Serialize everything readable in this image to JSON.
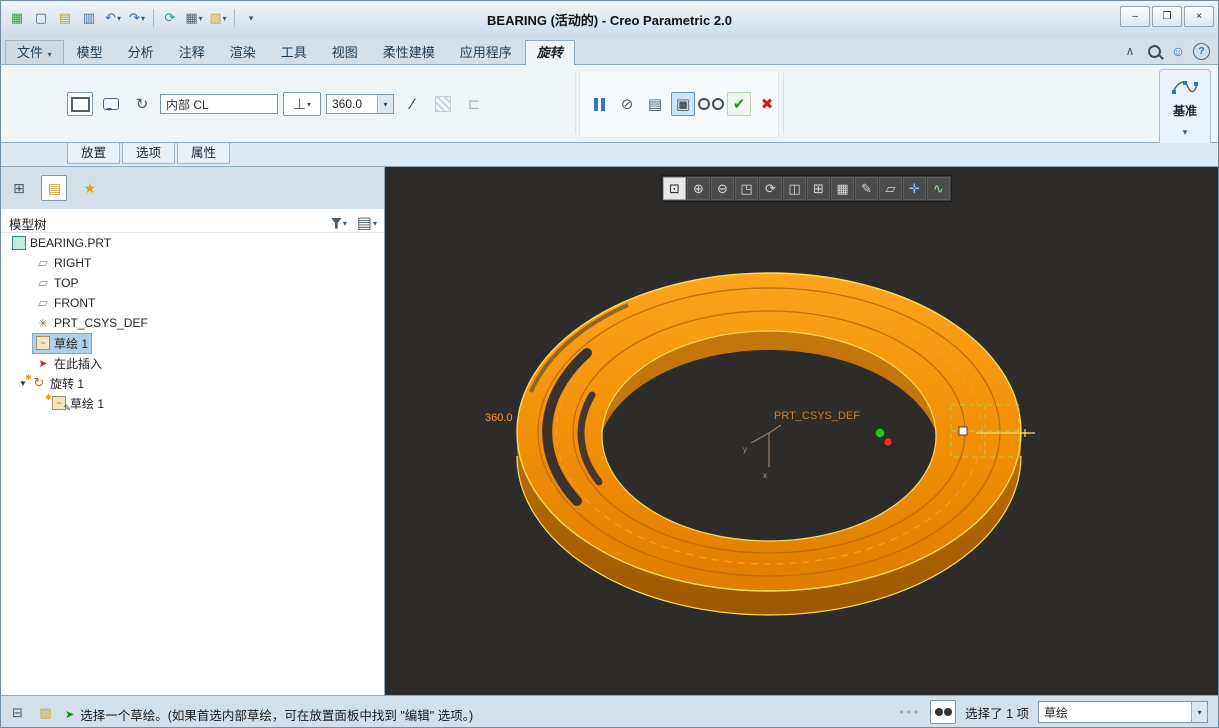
{
  "window": {
    "title": "BEARING (活动的) - Creo Parametric 2.0",
    "minimize_glyph": "–",
    "maximize_glyph": "❐",
    "close_glyph": "×"
  },
  "quick_access": {
    "icons": [
      {
        "name": "app-menu-icon",
        "glyph": "▦"
      },
      {
        "name": "new-file-icon",
        "glyph": "▢"
      },
      {
        "name": "open-file-icon",
        "glyph": "▤"
      },
      {
        "name": "save-icon",
        "glyph": "▥"
      },
      {
        "name": "undo-icon",
        "glyph": "↶",
        "arrow": "▾"
      },
      {
        "name": "redo-icon",
        "glyph": "↷",
        "arrow": "▾"
      },
      {
        "name": "regenerate-icon",
        "glyph": "⟳"
      },
      {
        "name": "windows-icon",
        "glyph": "▦",
        "arrow": "▾"
      },
      {
        "name": "open-folder-icon",
        "glyph": "▧",
        "arrow": "▾"
      },
      {
        "name": "customize-icon",
        "glyph": "▾"
      }
    ]
  },
  "tab_bar": {
    "tabs": [
      {
        "label": "文件",
        "arrow": "▾"
      },
      {
        "label": "模型"
      },
      {
        "label": "分析"
      },
      {
        "label": "注释"
      },
      {
        "label": "渲染"
      },
      {
        "label": "工具"
      },
      {
        "label": "视图"
      },
      {
        "label": "柔性建模"
      },
      {
        "label": "应用程序"
      },
      {
        "label": "旋转",
        "active": true
      }
    ],
    "right_icons": [
      {
        "name": "ribbon-collapse-icon",
        "glyph": "∧"
      },
      {
        "name": "search-icon",
        "glyph": "css-magnifier"
      },
      {
        "name": "community-icon",
        "glyph": "☺"
      },
      {
        "name": "help-icon",
        "glyph": "?"
      }
    ]
  },
  "ribbon": {
    "solid_button": "revolve-as-solid",
    "surface_button": "revolve-as-surface",
    "axis_glyph": "↻",
    "placement_value": "内部 CL",
    "angle_type_glyph": "⊥",
    "angle_type_arrow": "▾",
    "angle_value": "360.0",
    "reverse_glyph": "∕",
    "thin_glyph": "⊏",
    "no_preview_glyph": "⊘",
    "wireframe_preview_glyph": "▤",
    "shaded_preview_glyph": "▣",
    "ok_glyph": "✔",
    "cancel_glyph": "✖",
    "datum_group": {
      "label": "基准",
      "arrow": "▾"
    }
  },
  "panel_tabs": [
    {
      "label": "放置"
    },
    {
      "label": "选项"
    },
    {
      "label": "属性"
    }
  ],
  "model_tree": {
    "toolbar_icons": [
      {
        "name": "tree-display-icon",
        "glyph": "⊞"
      },
      {
        "name": "folder-navigator-icon",
        "glyph": "▤"
      },
      {
        "name": "favorites-icon",
        "glyph": "★"
      }
    ],
    "header": "模型树",
    "header_icons": [
      {
        "name": "filter-icon",
        "glyph": "css-funnel",
        "arrow": "▾"
      },
      {
        "name": "tree-columns-icon",
        "glyph": "▤",
        "arrow": "▾"
      }
    ],
    "items": [
      {
        "label": "BEARING.PRT",
        "icon": "part-icon",
        "level": 0
      },
      {
        "label": "RIGHT",
        "icon": "datum-plane-icon",
        "level": 1
      },
      {
        "label": "TOP",
        "icon": "datum-plane-icon",
        "level": 1
      },
      {
        "label": "FRONT",
        "icon": "datum-plane-icon",
        "level": 1
      },
      {
        "label": "PRT_CSYS_DEF",
        "icon": "csys-icon",
        "level": 1
      },
      {
        "label": "草绘 1",
        "icon": "sketch-icon",
        "level": 1,
        "selected": true
      },
      {
        "label": "在此插入",
        "icon": "insert-here-icon",
        "level": 1
      },
      {
        "label": "旋转 1",
        "icon": "revolve-icon",
        "level": 1,
        "expanded": true
      },
      {
        "label": "草绘 1",
        "icon": "sketch-edit-icon",
        "level": 2
      }
    ]
  },
  "viewport": {
    "toolbar": [
      {
        "name": "zoom-window-icon",
        "glyph": "⊡",
        "active": true
      },
      {
        "name": "zoom-in-icon",
        "glyph": "⊕"
      },
      {
        "name": "zoom-out-icon",
        "glyph": "⊖"
      },
      {
        "name": "refit-icon",
        "glyph": "◳"
      },
      {
        "name": "repaint-icon",
        "glyph": "⟳"
      },
      {
        "name": "display-style-icon",
        "glyph": "◫"
      },
      {
        "name": "saved-orientations-icon",
        "glyph": "⊞"
      },
      {
        "name": "view-manager-icon",
        "glyph": "▦"
      },
      {
        "name": "annotation-display-icon",
        "glyph": "✎"
      },
      {
        "name": "datum-display-icon",
        "glyph": "▱"
      },
      {
        "name": "spin-center-icon",
        "glyph": "✛"
      },
      {
        "name": "sketch-display-icon",
        "glyph": "∿"
      }
    ],
    "angle_label": "360.0",
    "csys_label": "PRT_CSYS_DEF",
    "axis_label_x": "x",
    "axis_label_y": "y"
  },
  "status_bar": {
    "left_icons": [
      {
        "name": "model-tree-toggle-icon",
        "glyph": "⊟"
      },
      {
        "name": "browser-toggle-icon",
        "glyph": "▨"
      }
    ],
    "prompt_glyph": "➤",
    "message": "选择一个草绘。(如果首选内部草绘，可在放置面板中找到 \"编辑\" 选项。)",
    "dots": "●●●",
    "selected_count": "选择了 1 项",
    "filter_value": "草绘",
    "filter_arrow": "▾"
  },
  "colors": {
    "model_orange": "#ef8f06",
    "viewport_bg": "#2e2b2b",
    "accent_blue": "#2c78c8",
    "highlight_yellow": "#f7df5e",
    "centerline_orange": "#ff9a2a",
    "selection_blue": "#afd0ea"
  }
}
